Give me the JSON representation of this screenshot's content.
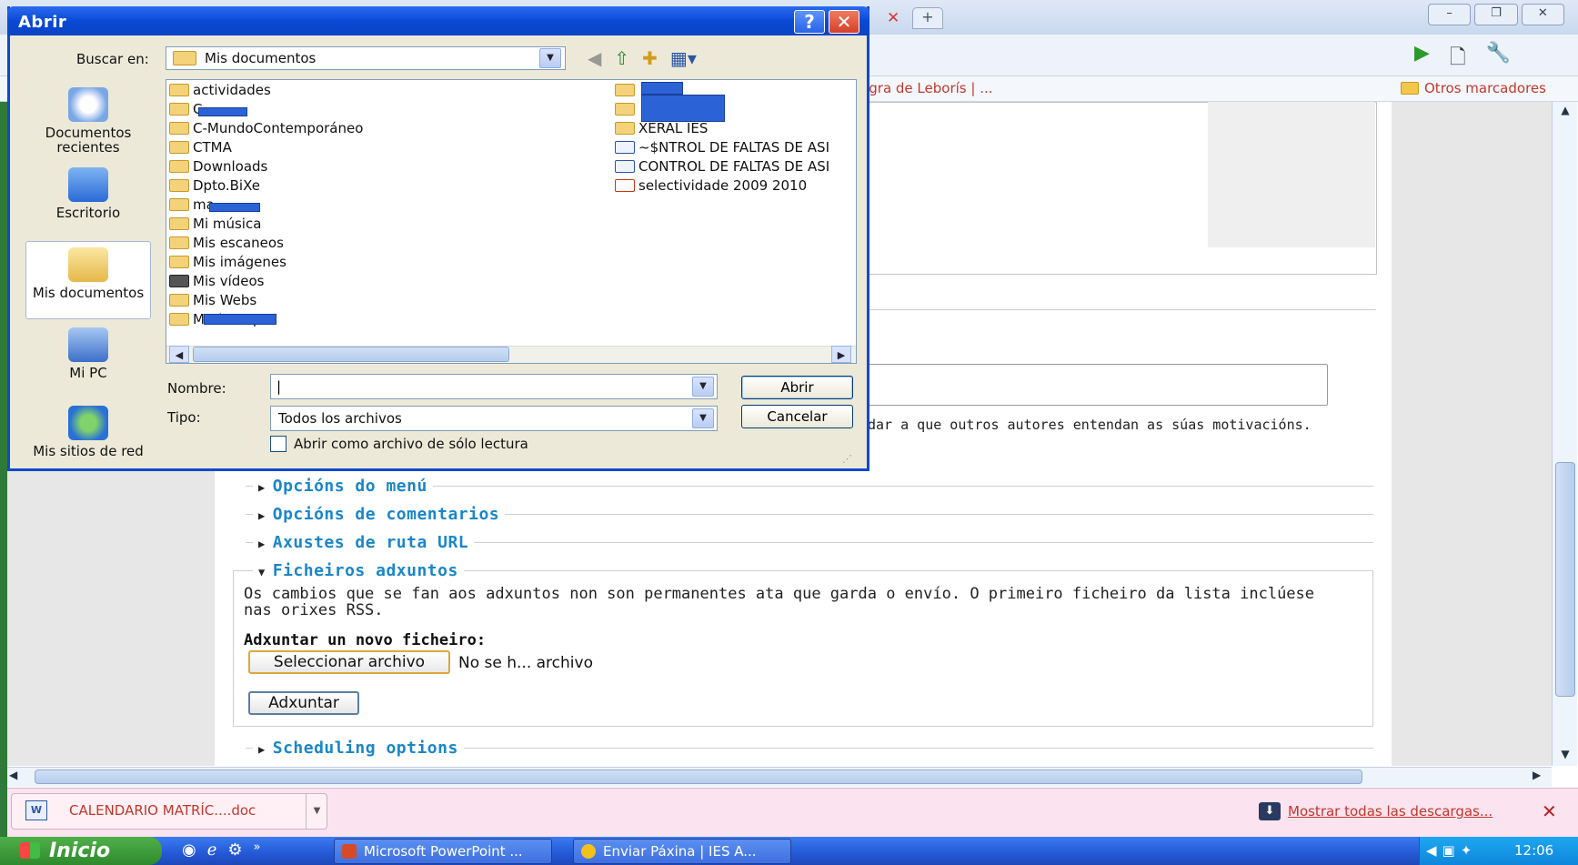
{
  "browser": {
    "bookmark_left": "Agra de Leborís | ...",
    "bookmark_other": "Otros marcadores",
    "help_text": "dar a que outros autores entendan as súas motivacións.",
    "sections": {
      "menu": "Opcións do menú",
      "comments": "Opcións de comentarios",
      "url": "Axustes de ruta URL",
      "files": "Ficheiros adxuntos",
      "scheduling": "Scheduling options"
    },
    "files_description": "Os cambios que se fan aos adxuntos non son permanentes ata que garda o envío. O primeiro ficheiro da lista inclúese nas orixes RSS.",
    "new_file_label": "Adxuntar un novo ficheiro:",
    "select_file_button": "Seleccionar archivo",
    "no_file_text": "No se h... archivo",
    "attach_button": "Adxuntar"
  },
  "downloads": {
    "item_name": "CALENDARIO MATRÍC....doc",
    "show_all": "Mostrar todas las descargas..."
  },
  "taskbar": {
    "start": "Inicio",
    "tasks": [
      "Microsoft PowerPoint ...",
      "Enviar Páxina | IES A..."
    ],
    "clock": "12:06"
  },
  "dialog": {
    "title": "Abrir",
    "look_in_label": "Buscar en:",
    "look_in_value": "Mis documentos",
    "places": [
      "Documentos recientes",
      "Escritorio",
      "Mis documentos",
      "Mi PC",
      "Mis sitios de red"
    ],
    "files_left": [
      {
        "name": "actividades",
        "type": "folder"
      },
      {
        "name": "C",
        "type": "folder"
      },
      {
        "name": "C-MundoContemporáneo",
        "type": "folder"
      },
      {
        "name": "CTMA",
        "type": "folder"
      },
      {
        "name": "Downloads",
        "type": "folder"
      },
      {
        "name": "Dpto.BiXe",
        "type": "folder"
      },
      {
        "name": "ma",
        "type": "folder"
      },
      {
        "name": "Mi música",
        "type": "folder"
      },
      {
        "name": "Mis escaneos",
        "type": "folder"
      },
      {
        "name": "Mis imágenes",
        "type": "folder"
      },
      {
        "name": "Mis vídeos",
        "type": "media"
      },
      {
        "name": "Mis Webs",
        "type": "folder"
      },
      {
        "name": "MariCrespo",
        "type": "folder"
      }
    ],
    "files_right": [
      {
        "name": "",
        "type": "folder"
      },
      {
        "name": "",
        "type": "folder"
      },
      {
        "name": "XERAL IES",
        "type": "folder"
      },
      {
        "name": "~$NTROL DE FALTAS DE ASI",
        "type": "doc"
      },
      {
        "name": "CONTROL DE FALTAS DE ASI",
        "type": "doc"
      },
      {
        "name": "selectividade 2009 2010",
        "type": "pdf"
      }
    ],
    "name_label": "Nombre:",
    "name_value": "|",
    "type_label": "Tipo:",
    "type_value": "Todos los archivos",
    "open_button": "Abrir",
    "cancel_button": "Cancelar",
    "readonly_label": "Abrir como archivo de sólo lectura"
  },
  "icons": [
    "search-icon",
    "folder-icon",
    "back-icon",
    "up-folder-icon",
    "new-folder-icon",
    "view-menu-icon",
    "play-icon",
    "page-icon",
    "wrench-icon"
  ],
  "colors": {
    "accent": "#1a86c8",
    "title_bar": "#0a49d6",
    "download_text": "#c0392b"
  }
}
